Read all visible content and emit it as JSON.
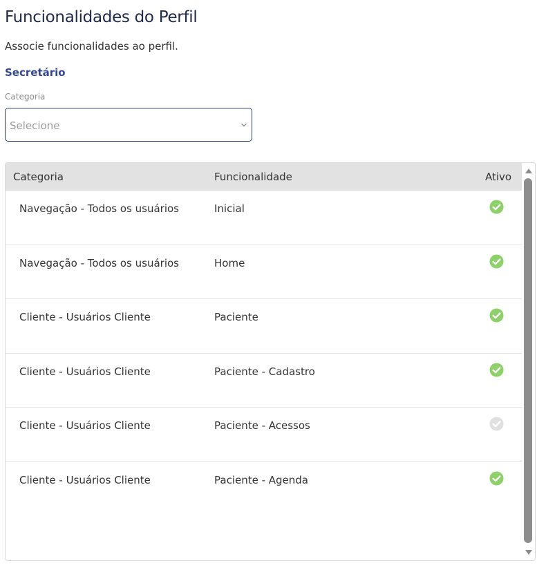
{
  "page": {
    "title": "Funcionalidades do Perfil",
    "subtitle": "Associe funcionalidades ao perfil.",
    "profile_name": "Secretário"
  },
  "filter": {
    "label": "Categoria",
    "placeholder": "Selecione"
  },
  "table": {
    "columns": {
      "category": "Categoria",
      "feature": "Funcionalidade",
      "active": "Ativo"
    },
    "rows": [
      {
        "category": "Navegação - Todos os usuários",
        "feature": "Inicial",
        "active": true
      },
      {
        "category": "Navegação - Todos os usuários",
        "feature": "Home",
        "active": true
      },
      {
        "category": "Cliente - Usuários Cliente",
        "feature": "Paciente",
        "active": true
      },
      {
        "category": "Cliente - Usuários Cliente",
        "feature": "Paciente - Cadastro",
        "active": true
      },
      {
        "category": "Cliente - Usuários Cliente",
        "feature": "Paciente - Acessos",
        "active": false
      },
      {
        "category": "Cliente - Usuários Cliente",
        "feature": "Paciente - Agenda",
        "active": true
      }
    ]
  },
  "colors": {
    "title": "#1f2a48",
    "profile": "#34478f",
    "border_accent": "#283b7c",
    "active_check": "#8ed16b",
    "inactive_check": "#e0e0e0",
    "header_bg": "#e2e2e2",
    "scroll_thumb": "#8d8d8d"
  },
  "icons": {
    "active": "check-circle-icon",
    "inactive": "check-circle-icon",
    "select": "chevron-down-icon",
    "scroll_up": "arrow-up-icon",
    "scroll_down": "arrow-down-icon"
  }
}
